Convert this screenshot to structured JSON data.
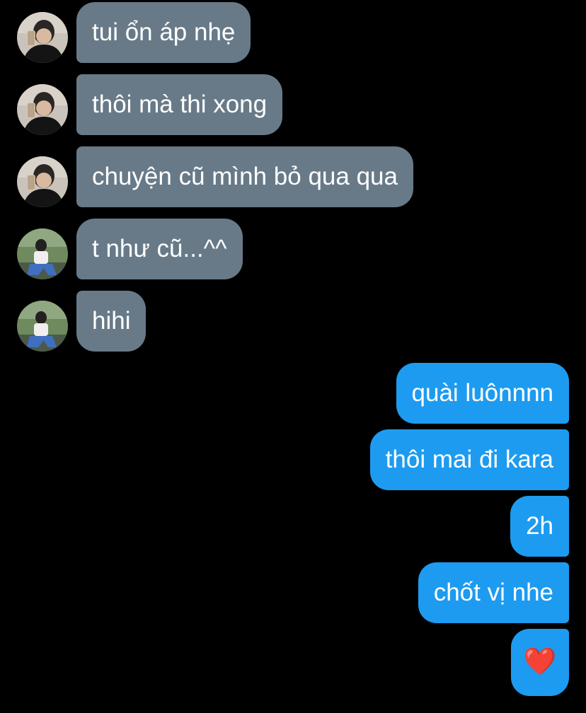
{
  "messages_in": [
    {
      "text": "tui ổn áp nhẹ",
      "avatar": "avatar-boy-black-jacket"
    },
    {
      "text": "thôi mà thi xong",
      "avatar": "avatar-boy-black-jacket"
    },
    {
      "text": "chuyện cũ mình bỏ qua qua",
      "avatar": "avatar-boy-black-jacket"
    },
    {
      "text": "t như cũ...^^",
      "avatar": "avatar-boy-sitting-outdoor"
    },
    {
      "text": "hihi",
      "avatar": "avatar-boy-sitting-outdoor"
    }
  ],
  "messages_out": [
    {
      "text": "quài luônnnn"
    },
    {
      "text": "thôi mai đi kara"
    },
    {
      "text": "2h"
    },
    {
      "text": "chốt vị nhe"
    },
    {
      "text": "❤️",
      "icon": "heart-emoji"
    }
  ],
  "colors": {
    "background": "#000000",
    "incoming_bubble": "#687a88",
    "outgoing_bubble": "#1d9bf0",
    "text": "#ffffff"
  }
}
